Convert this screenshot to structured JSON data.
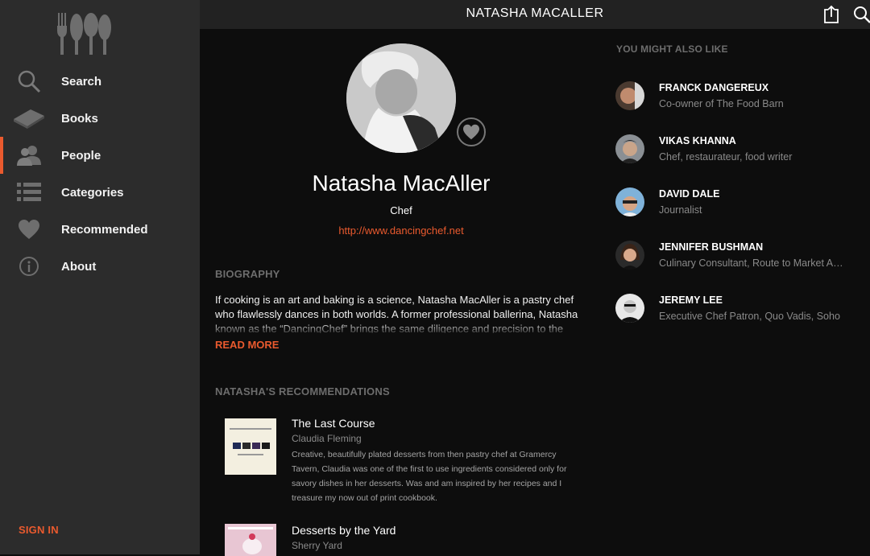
{
  "header": {
    "title": "NATASHA MACALLER"
  },
  "sidebar": {
    "items": [
      {
        "label": "Search"
      },
      {
        "label": "Books"
      },
      {
        "label": "People"
      },
      {
        "label": "Categories"
      },
      {
        "label": "Recommended"
      },
      {
        "label": "About"
      }
    ],
    "active": "People",
    "sign_in": "SIGN IN"
  },
  "profile": {
    "name": "Natasha MacAller",
    "role": "Chef",
    "website": "http://www.dancingchef.net"
  },
  "biography": {
    "heading": "BIOGRAPHY",
    "text": "If cooking is an art and baking is a science, Natasha MacAller is a pastry chef who flawlessly dances in both worlds. A former professional ballerina, Natasha known as the “DancingChef” brings the same diligence and precision to the",
    "read_more": "READ MORE"
  },
  "recommendations": {
    "heading": "NATASHA'S RECOMMENDATIONS",
    "items": [
      {
        "title": "The Last Course",
        "author": "Claudia Fleming",
        "description": "Creative, beautifully plated desserts from then pastry chef at Gramercy Tavern, Claudia was one of the first to use ingredients considered only for savory dishes in her desserts. Was and am inspired by her recipes and I treasure my now out of print cookbook."
      },
      {
        "title": "Desserts by the Yard",
        "author": "Sherry Yard",
        "description": ""
      }
    ]
  },
  "also_like": {
    "heading": "YOU MIGHT ALSO LIKE",
    "people": [
      {
        "name": "FRANCK DANGEREUX",
        "desc": "Co-owner of The Food Barn"
      },
      {
        "name": "VIKAS KHANNA",
        "desc": "Chef, restaurateur, food writer"
      },
      {
        "name": "DAVID DALE",
        "desc": "Journalist"
      },
      {
        "name": "JENNIFER BUSHMAN",
        "desc": "Culinary Consultant, Route to Market Advisor"
      },
      {
        "name": "JEREMY LEE",
        "desc": "Executive Chef Patron, Quo Vadis, Soho"
      }
    ]
  },
  "colors": {
    "accent": "#ea5a2e",
    "sidebar": "#2c2c2c",
    "background": "#0d0d0d"
  },
  "icons": [
    "utensils-logo-icon",
    "search-icon",
    "book-icon",
    "people-icon",
    "list-icon",
    "heart-icon",
    "info-icon",
    "share-icon",
    "favorite-heart-icon"
  ]
}
